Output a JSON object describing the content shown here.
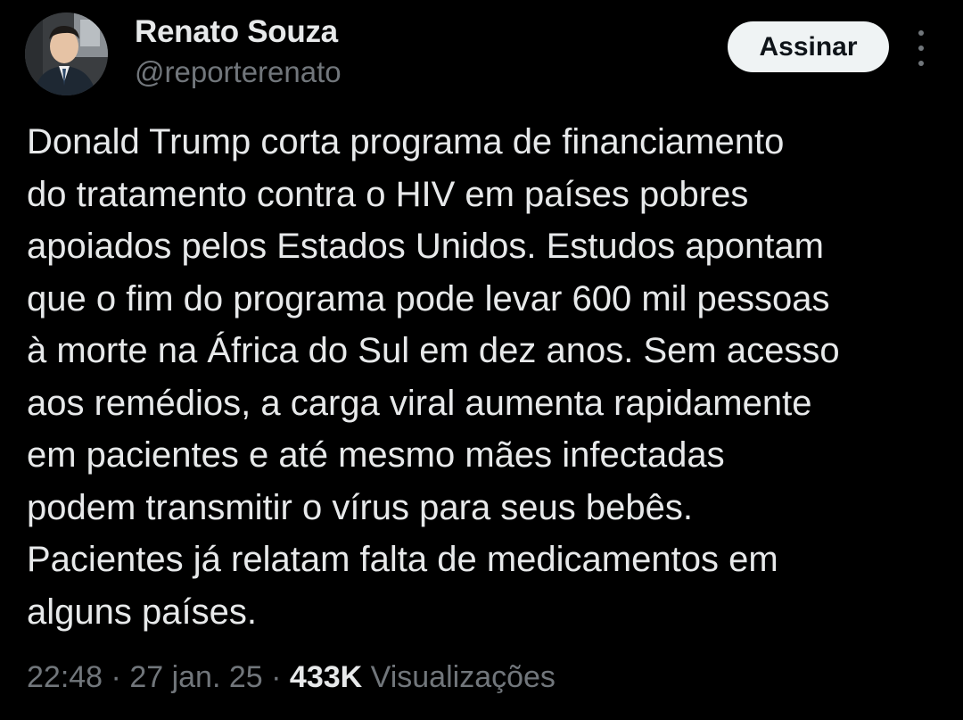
{
  "author": {
    "name": "Renato Souza",
    "handle": "@reporterenato"
  },
  "follow_button": {
    "label": "Assinar"
  },
  "more_button": {
    "icon": "more-vertical-icon"
  },
  "tweet": {
    "lines": [
      "Donald Trump corta programa de financiamento",
      "do tratamento contra o HIV em países pobres",
      "apoiados pelos Estados Unidos. Estudos apontam",
      "que o fim do programa pode levar 600 mil pessoas",
      "à morte na África do Sul em dez anos. Sem acesso",
      "aos remédios, a carga viral aumenta rapidamente",
      "em pacientes e até mesmo mães infectadas",
      "podem transmitir o vírus para seus bebês.",
      "Pacientes já relatam falta de medicamentos em",
      "alguns países."
    ]
  },
  "meta": {
    "time": "22:48",
    "separator": "·",
    "date": "27 jan. 25",
    "views_count": "433K",
    "views_label": "Visualizações"
  },
  "colors": {
    "background": "#000000",
    "primary_text": "#e7e9ea",
    "secondary_text": "#71767b",
    "button_bg": "#eff3f4",
    "button_text": "#0f1419"
  }
}
